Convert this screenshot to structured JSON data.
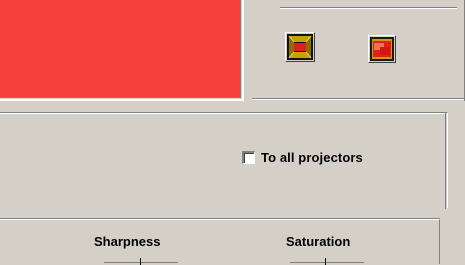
{
  "preview": {
    "color": "#f5403c"
  },
  "buttons": {
    "view_a_icon": "frame-red-icon",
    "view_b_icon": "screen-red-icon"
  },
  "options": {
    "apply_all_label": "To all projectors",
    "apply_all_checked": false
  },
  "table": {
    "columns": [
      "Sharpness",
      "Saturation"
    ]
  }
}
